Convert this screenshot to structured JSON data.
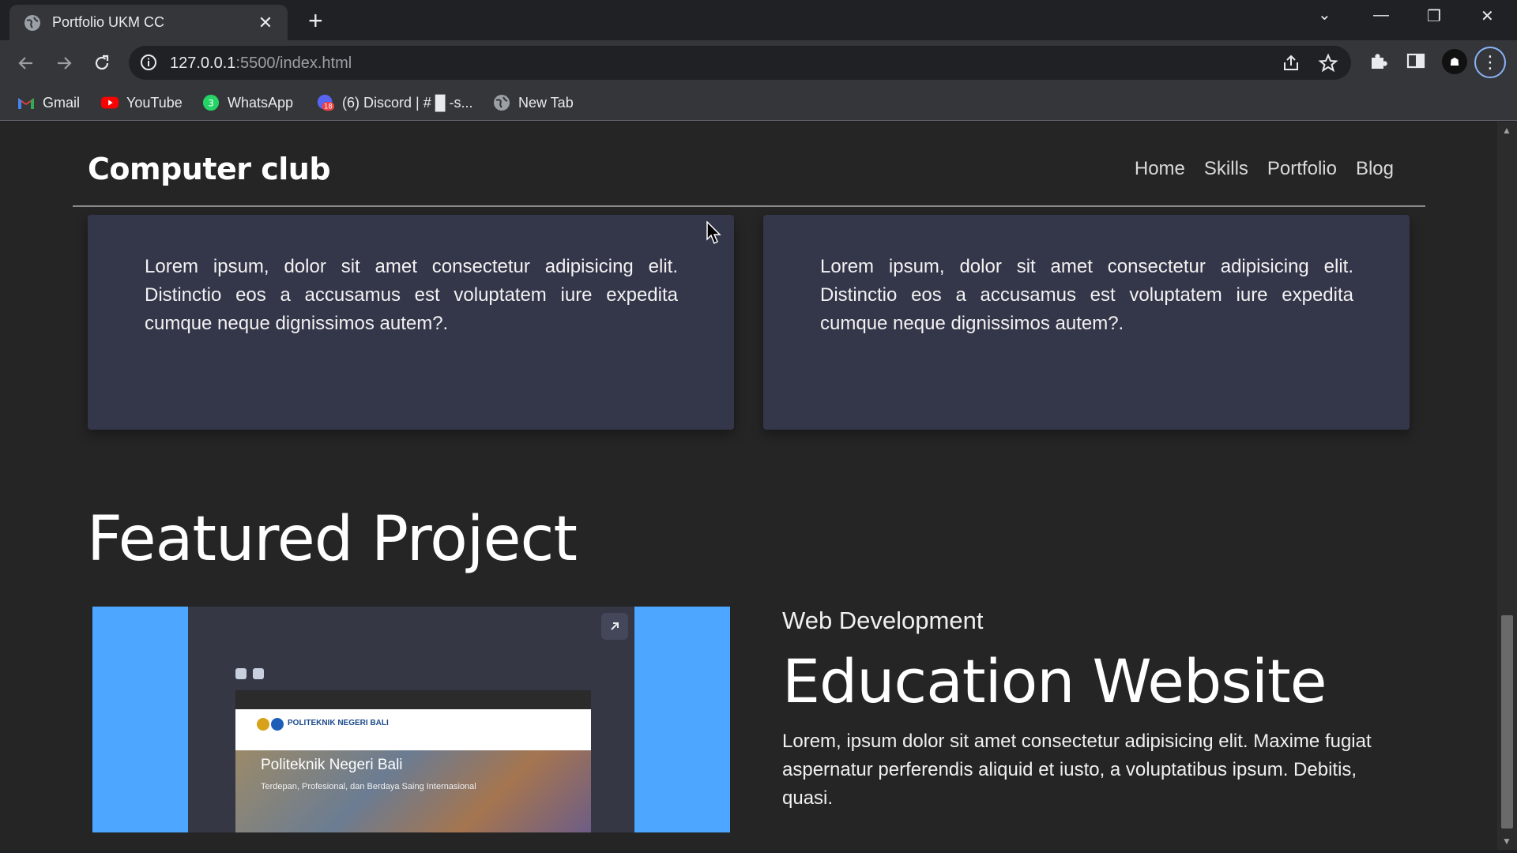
{
  "browser": {
    "tab_title": "Portfolio UKM CC",
    "url_host": "127.0.0.1",
    "url_path": ":5500/index.html",
    "bookmarks": [
      {
        "label": "Gmail",
        "icon": "gmail-icon"
      },
      {
        "label": "YouTube",
        "icon": "youtube-icon"
      },
      {
        "label": "WhatsApp",
        "icon": "whatsapp-icon",
        "badge": "3"
      },
      {
        "label": "(6) Discord | # █ -s...",
        "icon": "discord-icon",
        "badge": "18"
      },
      {
        "label": "New Tab",
        "icon": "globe-icon"
      }
    ]
  },
  "site": {
    "brand": "Computer club",
    "nav": [
      "Home",
      "Skills",
      "Portfolio",
      "Blog"
    ]
  },
  "cards": [
    {
      "text": "Lorem ipsum, dolor sit amet consectetur adipisicing elit. Distinctio eos a accusamus est voluptatem iure expedita cumque neque dignissimos autem?."
    },
    {
      "text": "Lorem ipsum, dolor sit amet consectetur adipisicing elit. Distinctio eos a accusamus est voluptatem iure expedita cumque neque dignissimos autem?."
    }
  ],
  "featured": {
    "section_title": "Featured Project",
    "category": "Web Development",
    "title": "Education Website",
    "description": "Lorem, ipsum dolor sit amet consectetur adipisicing elit. Maxime fugiat aspernatur perferendis aliquid et iusto, a voluptatibus ipsum. Debitis, quasi.",
    "screenshot": {
      "site_name": "POLITEKNIK NEGERI BALI",
      "hero_title": "Politeknik Negeri Bali",
      "hero_subtitle": "Terdepan, Profesional, dan Berdaya Saing Internasional"
    }
  },
  "colors": {
    "page_bg": "#252525",
    "card_bg": "#34364a",
    "project_accent": "#4da6ff"
  }
}
